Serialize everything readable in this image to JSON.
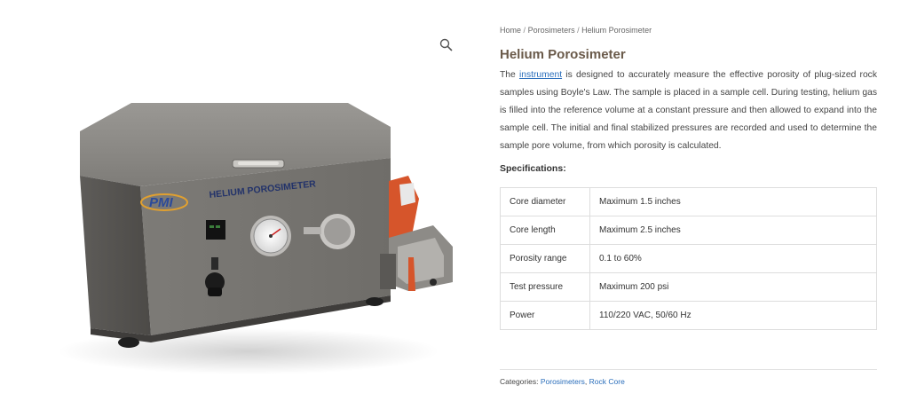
{
  "product": {
    "image_alt": "Helium Porosimeter unit",
    "panel_brand": "PMI",
    "panel_label": "HELIUM POROSIMETER"
  },
  "zoom_icon": "magnifier-icon",
  "breadcrumb": {
    "items": [
      "Home",
      "Porosimeters",
      "Helium Porosimeter"
    ],
    "separator": "/"
  },
  "title": "Helium Porosimeter",
  "description": {
    "prefix": "The ",
    "link_text": "instrument",
    "body": " is designed to accurately measure the effective porosity of plug-sized rock samples using Boyle's Law. The sample is placed in a sample cell. During testing, helium gas is filled into the reference volume at a constant pressure and then allowed to expand into the sample cell. The initial and final stabilized pressures are recorded and used to determine the sample pore volume, from which porosity is calculated."
  },
  "specs_heading": "Specifications:",
  "specs": [
    {
      "key": "Core diameter",
      "value": "Maximum 1.5 inches"
    },
    {
      "key": "Core length",
      "value": "Maximum 2.5 inches"
    },
    {
      "key": "Porosity range",
      "value": "0.1 to 60%"
    },
    {
      "key": "Test pressure",
      "value": "Maximum 200 psi"
    },
    {
      "key": "Power",
      "value": "110/220 VAC, 50/60 Hz"
    }
  ],
  "categories": {
    "label": "Categories: ",
    "items": [
      "Porosimeters",
      "Rock Core"
    ],
    "separator": ", "
  },
  "colors": {
    "title": "#6a5a4a",
    "link": "#2a6ebb",
    "cabinet": "#7b7975",
    "accent_orange": "#d6552b"
  }
}
